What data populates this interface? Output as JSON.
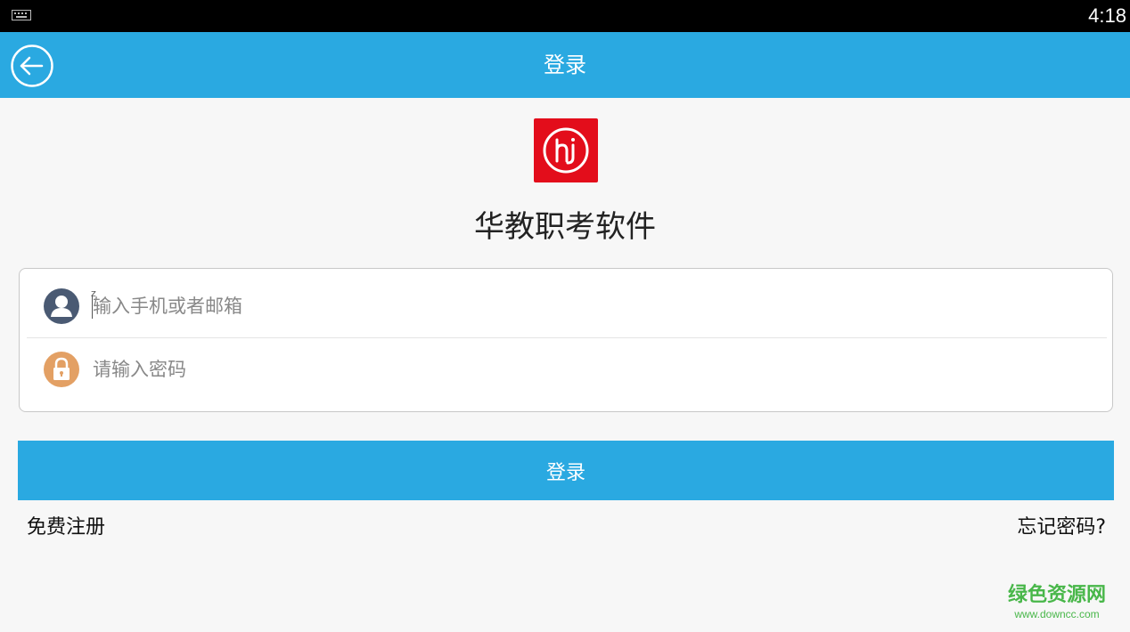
{
  "status_bar": {
    "time": "4:18",
    "keyboard_icon": "keyboard-icon"
  },
  "app_bar": {
    "title": "登录",
    "back_icon": "back-arrow-icon"
  },
  "branding": {
    "logo_text": "hj",
    "app_name": "华教职考软件"
  },
  "form": {
    "username": {
      "placeholder": "输入手机或者邮箱",
      "value": "",
      "icon": "user-icon"
    },
    "password": {
      "placeholder": "请输入密码",
      "value": "",
      "icon": "lock-icon"
    }
  },
  "actions": {
    "login_label": "登录",
    "register_label": "免费注册",
    "forgot_label": "忘记密码?"
  },
  "watermark": {
    "title": "绿色资源网",
    "url": "www.downcc.com"
  },
  "colors": {
    "primary": "#2aa9e1",
    "logo_red": "#e30d1b",
    "user_icon": "#4a5a73",
    "lock_icon": "#e3a064",
    "watermark_green": "#49b74a"
  }
}
